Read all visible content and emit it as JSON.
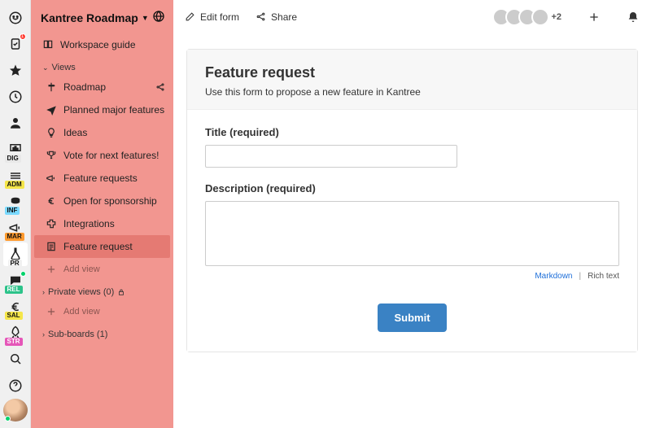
{
  "rail": {
    "badges": {
      "dig": "DIG",
      "adm": "ADM",
      "inf": "INF",
      "mar": "MAR",
      "pr": "PR",
      "rel": "REL",
      "sal": "SAL",
      "str": "STR"
    },
    "notif": "1"
  },
  "sidebar": {
    "title": "Kantree Roadmap",
    "workspace_guide": "Workspace guide",
    "views_label": "Views",
    "items": {
      "roadmap": "Roadmap",
      "planned": "Planned major features",
      "ideas": "Ideas",
      "vote": "Vote for next features!",
      "feature_requests": "Feature requests",
      "sponsorship": "Open for sponsorship",
      "integrations": "Integrations",
      "feature_request": "Feature request"
    },
    "add_view": "Add view",
    "private_views": "Private views (0)",
    "sub_boards": "Sub-boards (1)"
  },
  "topbar": {
    "edit_form": "Edit form",
    "share": "Share",
    "more_count": "+2"
  },
  "form": {
    "title": "Feature request",
    "subtitle": "Use this form to propose a new feature in Kantree",
    "field_title": "Title (required)",
    "field_desc": "Description (required)",
    "markdown": "Markdown",
    "richtext": "Rich text",
    "submit": "Submit"
  }
}
